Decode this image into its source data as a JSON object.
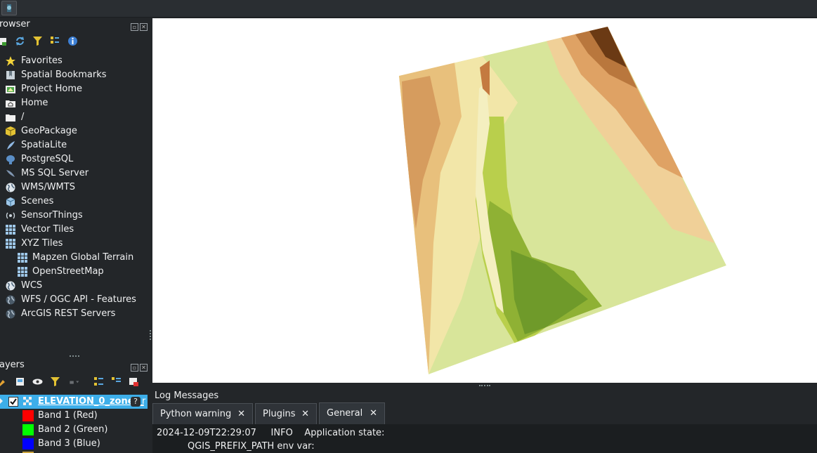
{
  "browser": {
    "title": "rowser",
    "items": [
      {
        "label": "Favorites",
        "icon": "star-icon"
      },
      {
        "label": "Spatial Bookmarks",
        "icon": "bookmark-icon"
      },
      {
        "label": "Project Home",
        "icon": "project-home-icon"
      },
      {
        "label": "Home",
        "icon": "home-folder-icon"
      },
      {
        "label": "/",
        "icon": "folder-icon"
      },
      {
        "label": "GeoPackage",
        "icon": "geopackage-icon"
      },
      {
        "label": "SpatiaLite",
        "icon": "spatialite-icon"
      },
      {
        "label": "PostgreSQL",
        "icon": "postgresql-icon"
      },
      {
        "label": "MS SQL Server",
        "icon": "mssql-icon"
      },
      {
        "label": "WMS/WMTS",
        "icon": "wms-globe-icon"
      },
      {
        "label": "Scenes",
        "icon": "scenes-cube-icon"
      },
      {
        "label": "SensorThings",
        "icon": "sensorthings-icon"
      },
      {
        "label": "Vector Tiles",
        "icon": "vector-tiles-grid-icon"
      },
      {
        "label": "XYZ Tiles",
        "icon": "xyz-tiles-grid-icon"
      },
      {
        "label": "Mapzen Global Terrain",
        "icon": "tile-grid-icon"
      },
      {
        "label": "OpenStreetMap",
        "icon": "tile-grid-icon"
      },
      {
        "label": "WCS",
        "icon": "wcs-globe-icon"
      },
      {
        "label": "WFS / OGC API - Features",
        "icon": "wfs-globe-icon"
      },
      {
        "label": "ArcGIS REST Servers",
        "icon": "arcgis-globe-icon"
      }
    ]
  },
  "layers": {
    "title": "ayers",
    "layer_name": "ELEVATION_0_zones_",
    "layer_suffix": "r",
    "bands": [
      {
        "label": "Band 1 (Red)",
        "color": "#ff0000"
      },
      {
        "label": "Band 2 (Green)",
        "color": "#00ff00"
      },
      {
        "label": "Band 3 (Blue)",
        "color": "#0000ff"
      }
    ]
  },
  "log": {
    "title": "Log Messages",
    "tabs": [
      {
        "label": "Python warning"
      },
      {
        "label": "Plugins"
      },
      {
        "label": "General"
      }
    ],
    "close_glyph": "✕",
    "line1": "2024-12-09T22:29:07     INFO    Application state:",
    "line2": "QGIS_PREFIX_PATH env var:"
  },
  "colors": {
    "accent": "#3daee9",
    "terrain_low": "#5a8a1e",
    "terrain_mid": "#c7d66a",
    "terrain_high": "#6b3a14"
  }
}
